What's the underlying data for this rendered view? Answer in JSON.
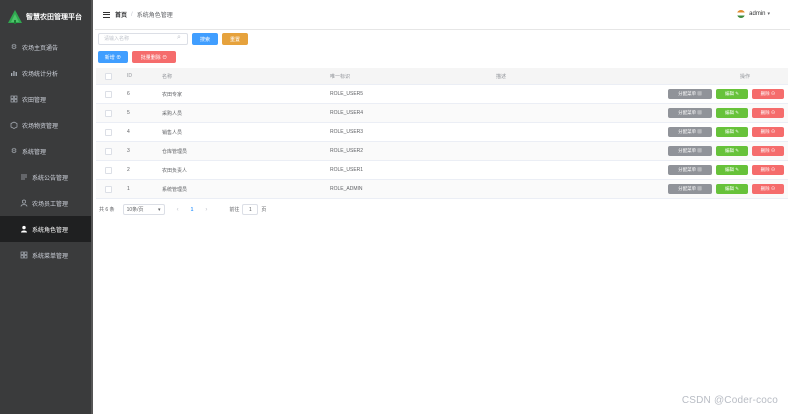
{
  "app": {
    "title": "智慧农田管理平台"
  },
  "sidebar": {
    "items": [
      {
        "label": "农场主页通告",
        "icon": "gear-icon"
      },
      {
        "label": "农场统计分析",
        "icon": "chart-icon"
      },
      {
        "label": "农田管理",
        "icon": "grid-icon"
      },
      {
        "label": "农场物资管理",
        "icon": "box-icon"
      },
      {
        "label": "系统管理",
        "icon": "gear-icon"
      },
      {
        "label": "系统公告管理",
        "icon": "list-icon"
      },
      {
        "label": "农场员工管理",
        "icon": "user-icon"
      },
      {
        "label": "系统角色管理",
        "icon": "user-icon"
      },
      {
        "label": "系统菜单管理",
        "icon": "grid-icon"
      }
    ]
  },
  "header": {
    "breadcrumb_home": "首页",
    "breadcrumb_sep": "/",
    "breadcrumb_current": "系统角色管理",
    "user_name": "admin"
  },
  "search": {
    "placeholder": "请输入名称",
    "search_label": "搜索",
    "reset_label": "重置"
  },
  "toolbar": {
    "add_label": "新增 ⊕",
    "batch_delete_label": "批量删除 ⊖"
  },
  "table": {
    "headers": {
      "id": "ID",
      "name": "名称",
      "flag": "唯一标识",
      "desc": "描述",
      "op": "操作"
    },
    "rows": [
      {
        "id": "6",
        "name": "农田专家",
        "flag": "ROLE_USER5",
        "desc": ""
      },
      {
        "id": "5",
        "name": "采购人员",
        "flag": "ROLE_USER4",
        "desc": ""
      },
      {
        "id": "4",
        "name": "销售人员",
        "flag": "ROLE_USER3",
        "desc": ""
      },
      {
        "id": "3",
        "name": "仓库管理员",
        "flag": "ROLE_USER2",
        "desc": ""
      },
      {
        "id": "2",
        "name": "农田负责人",
        "flag": "ROLE_USER1",
        "desc": ""
      },
      {
        "id": "1",
        "name": "系统管理员",
        "flag": "ROLE_ADMIN",
        "desc": ""
      }
    ],
    "row_actions": {
      "assign": "分配菜单 ▦",
      "edit": "编辑 ✎",
      "delete": "删除 ⊖"
    }
  },
  "pagination": {
    "total": "共 6 条",
    "page_size": "10条/页",
    "prev": "‹",
    "page": "1",
    "next": "›",
    "goto_label": "前往",
    "goto_value": "1",
    "goto_suffix": "页"
  },
  "watermark": "CSDN @Coder-coco"
}
